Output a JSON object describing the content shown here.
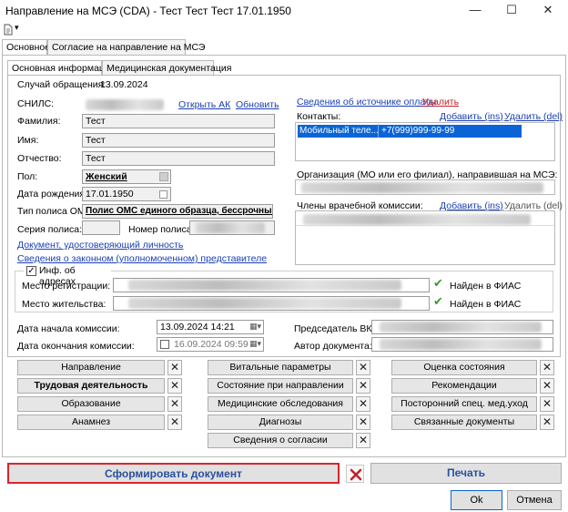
{
  "window": {
    "title": "Направление на МСЭ (CDA) - Тест Тест Тест 17.01.1950",
    "minimize": "—",
    "maximize": "☐",
    "close": "✕"
  },
  "toolbar": {
    "icon": "document-menu-icon",
    "arrow": "▾"
  },
  "tabs": {
    "main": "Основное",
    "consent": "Согласие на направление на МСЭ"
  },
  "subtabs": {
    "info": "Основная информация",
    "medical": "Медицинская документация"
  },
  "case": {
    "label": "Случай обращения:",
    "value": "13.09.2024"
  },
  "person": {
    "snils_label": "СНИЛС:",
    "open_ak": "Открыть АК",
    "refresh": "Обновить",
    "surname_label": "Фамилия:",
    "surname": "Тест",
    "name_label": "Имя:",
    "name": "Тест",
    "patronymic_label": "Отчество:",
    "patronymic": "Тест",
    "gender_label": "Пол:",
    "gender": "Женский",
    "birth_label": "Дата рождения:",
    "birth": "17.01.1950",
    "policy_type_label": "Тип полиса ОМС:",
    "policy_type": "Полис ОМС единого образца, бессрочный",
    "policy_series_label": "Серия полиса:",
    "policy_number_label": "Номер полиса:",
    "identity_doc": "Документ, удостоверяющий личность",
    "legal_rep": "Сведения о законном (уполномоченном) представителе"
  },
  "payment": {
    "info": "Сведения об источнике оплаты",
    "delete": "Удалить"
  },
  "contacts": {
    "label": "Контакты:",
    "add": "Добавить (ins)",
    "delete": "Удалить (del)",
    "type": "Мобильный теле...",
    "value": "+7(999)999-99-99"
  },
  "organization": {
    "label": "Организация (МО или его филиал), направившая на МСЭ:"
  },
  "commission": {
    "label": "Члены врачебной комиссии:",
    "add": "Добавить (ins)",
    "delete": "Удалить (del)"
  },
  "address": {
    "section_label": "Инф. об адресах",
    "registration_label": "Место регистрации:",
    "residence_label": "Место жительства:",
    "fias_found": "Найден в ФИАС"
  },
  "dates": {
    "start_label": "Дата начала комиссии:",
    "start_value": "13.09.2024 14:21",
    "end_label": "Дата окончания комиссии:",
    "end_value": "16.09.2024 09:59",
    "chairman_label": "Председатель ВК:",
    "author_label": "Автор документа:"
  },
  "sections": {
    "col1": [
      "Направление",
      "Трудовая деятельность",
      "Образование",
      "Анамнез"
    ],
    "col2": [
      "Витальные параметры",
      "Состояние при направлении",
      "Медицинские обследования",
      "Диагнозы",
      "Сведения о согласии"
    ],
    "col3": [
      "Оценка состояния",
      "Рекомендации",
      "Посторонний спец. мед.уход",
      "Связанные документы"
    ]
  },
  "actions": {
    "generate": "Сформировать документ",
    "print": "Печать",
    "ok": "Ok",
    "cancel": "Отмена"
  },
  "colors": {
    "link": "#1a3fb5",
    "danger": "#c2202a",
    "selection": "#0a64d6",
    "fias_ok": "#3a9b2a"
  }
}
